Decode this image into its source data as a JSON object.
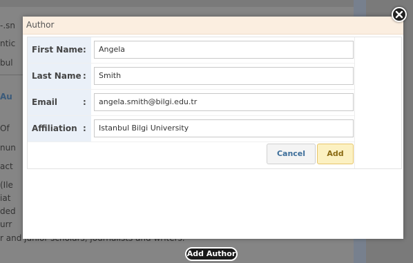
{
  "background": {
    "lines": [
      "-.sn",
      "ntic",
      "bul",
      "Au",
      "Of",
      "nun",
      "act",
      "(Ile",
      "iat",
      "ded",
      "urr"
    ],
    "footer_text": "r and junior scholars, journalists and writers."
  },
  "modal": {
    "title": "Author",
    "fields": [
      {
        "label": "First Name",
        "value": "Angela"
      },
      {
        "label": "Last Name",
        "value": "Smith"
      },
      {
        "label": "Email",
        "value": "angela.smith@bilgi.edu.tr"
      },
      {
        "label": "Affiliation",
        "value": "Istanbul Bilgi University"
      }
    ],
    "separator": ":",
    "cancel_label": "Cancel",
    "add_label": "Add"
  },
  "add_author_label": "Add Author",
  "icons": {
    "close": "close-icon"
  },
  "colors": {
    "header_bg": "#fbeee0",
    "label_bg": "#eaf0f8",
    "add_bg": "#fcf1c2",
    "cancel_text": "#3d6e9a"
  }
}
